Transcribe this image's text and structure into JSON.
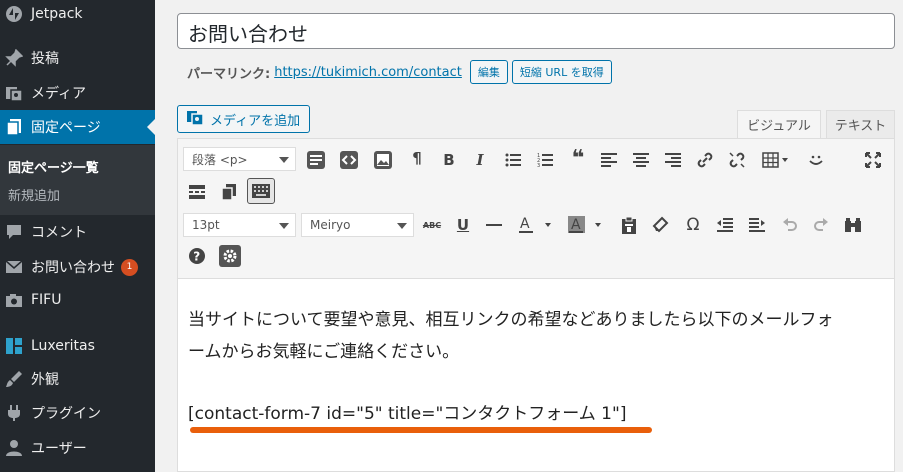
{
  "sidebar": {
    "items": [
      {
        "label": "Jetpack",
        "icon": "jetpack-icon"
      },
      {
        "label": "投稿",
        "icon": "pin-icon"
      },
      {
        "label": "メディア",
        "icon": "media-icon"
      },
      {
        "label": "固定ページ",
        "icon": "page-icon",
        "current": true
      },
      {
        "label": "コメント",
        "icon": "comment-icon"
      },
      {
        "label": "お問い合わせ",
        "icon": "mail-icon",
        "badge": "1"
      },
      {
        "label": "FIFU",
        "icon": "camera-icon"
      },
      {
        "label": "Luxeritas",
        "icon": "grid-icon"
      },
      {
        "label": "外観",
        "icon": "brush-icon"
      },
      {
        "label": "プラグイン",
        "icon": "plug-icon"
      },
      {
        "label": "ユーザー",
        "icon": "user-icon"
      }
    ],
    "submenu": [
      "固定ページ一覧",
      "新規追加"
    ]
  },
  "editor": {
    "title": "お問い合わせ",
    "permalink_label": "パーマリンク:",
    "permalink_url": "https://tukimich.com/contact",
    "edit_button": "編集",
    "shortlink_button": "短縮 URL を取得",
    "add_media": "メディアを追加",
    "tab_visual": "ビジュアル",
    "tab_text": "テキスト",
    "format_select": "段落 <p>",
    "size_select": "13pt",
    "font_select": "Meiryo",
    "content_line1": "当サイトについて要望や意見、相互リンクの希望などありましたら以下のメールフォ",
    "content_line2": "ームからお気軽にご連絡ください。",
    "shortcode": "[contact-form-7 id=\"5\" title=\"コンタクトフォーム 1\"]"
  },
  "colors": {
    "sidebar_bg": "#23282d",
    "accent": "#0073aa",
    "badge": "#d54e21",
    "highlight_underline": "#e95f0b"
  }
}
